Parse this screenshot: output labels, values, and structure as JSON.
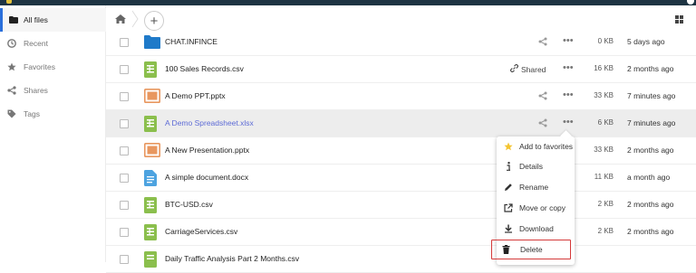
{
  "sidebar": {
    "items": [
      {
        "label": "All files",
        "icon": "folder-icon",
        "active": true
      },
      {
        "label": "Recent",
        "icon": "clock-icon"
      },
      {
        "label": "Favorites",
        "icon": "star-icon"
      },
      {
        "label": "Shares",
        "icon": "share-icon"
      },
      {
        "label": "Tags",
        "icon": "tag-icon"
      }
    ]
  },
  "breadcrumb": {
    "add_label": "+"
  },
  "files": [
    {
      "name": "CHAT.INFINCE",
      "type": "folder",
      "shared_label": "",
      "size": "0 KB",
      "modified": "5 days ago"
    },
    {
      "name": "100 Sales Records.csv",
      "type": "spreadsheet",
      "shared_label": "Shared",
      "size": "16 KB",
      "modified": "2 months ago"
    },
    {
      "name": "A Demo PPT.pptx",
      "type": "presentation",
      "shared_label": "",
      "size": "33 KB",
      "modified": "7 minutes ago"
    },
    {
      "name": "A Demo Spreadsheet.xlsx",
      "type": "spreadsheet",
      "shared_label": "",
      "size": "6 KB",
      "modified": "7 minutes ago"
    },
    {
      "name": "A New Presentation.pptx",
      "type": "presentation",
      "shared_label": "",
      "size": "33 KB",
      "modified": "2 months ago"
    },
    {
      "name": "A simple document.docx",
      "type": "document",
      "shared_label": "",
      "size": "11 KB",
      "modified": "a month ago"
    },
    {
      "name": "BTC-USD.csv",
      "type": "spreadsheet",
      "shared_label": "",
      "size": "2 KB",
      "modified": "2 months ago"
    },
    {
      "name": "CarriageServices.csv",
      "type": "spreadsheet",
      "shared_label": "",
      "size": "2 KB",
      "modified": "2 months ago"
    },
    {
      "name": "Daily Traffic Analysis Part 2 Months.csv",
      "type": "spreadsheet",
      "shared_label": "",
      "size": "",
      "modified": ""
    }
  ],
  "context_menu": {
    "items": [
      {
        "label": "Add to favorites",
        "icon": "star-icon"
      },
      {
        "label": "Details",
        "icon": "info-icon"
      },
      {
        "label": "Rename",
        "icon": "pencil-icon"
      },
      {
        "label": "Move or copy",
        "icon": "external-link-icon"
      },
      {
        "label": "Download",
        "icon": "download-icon"
      },
      {
        "label": "Delete",
        "icon": "trash-icon"
      }
    ]
  },
  "colors": {
    "topbar": "#1e3443",
    "active_accent": "#2a6fdb",
    "folder": "#1f7ac9",
    "spreadsheet": "#8bbf4d",
    "presentation": "#e8975f",
    "document": "#4da3e0",
    "highlight_link": "#5d6bd6",
    "delete_outline": "#d43a3a"
  }
}
